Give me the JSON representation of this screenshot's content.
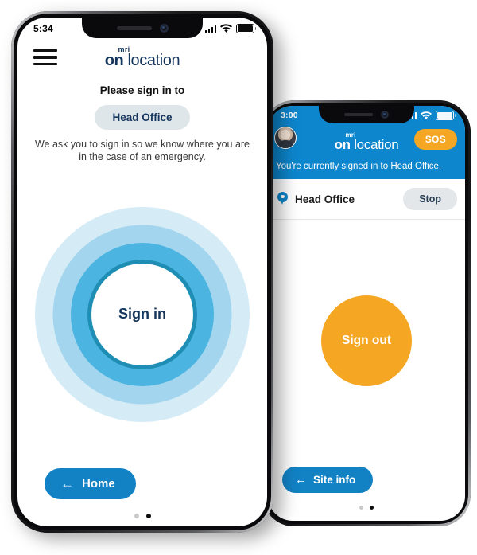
{
  "colors": {
    "brand_blue": "#0d86cd",
    "nav_blue": "#1282c5",
    "navy": "#14355c",
    "orange": "#f5a623",
    "ring_1": "#d5ecf7",
    "ring_2": "#a3d6ee",
    "ring_3": "#4cb4e0",
    "ring_4": "#1f8eb5",
    "pill_grey": "#dfe6ea"
  },
  "phone_left": {
    "status_bar": {
      "time": "5:34",
      "signal_icon": "cellular-bars-icon",
      "wifi_icon": "wifi-icon",
      "battery_icon": "battery-full-icon"
    },
    "header": {
      "menu_icon": "hamburger-menu-icon",
      "logo_top": "mri",
      "logo_main_bold": "on",
      "logo_main_thin": " location"
    },
    "prompt": "Please sign in to",
    "site_pill_label": "Head Office",
    "blurb": "We ask you to sign in so we know where you are in the case of an emergency.",
    "signin_label": "Sign in",
    "nav_button": {
      "arrow_icon": "arrow-left-icon",
      "label": "Home"
    },
    "page_dots": {
      "total": 2,
      "active_index": 1
    }
  },
  "phone_right": {
    "status_bar": {
      "time": "3:00",
      "signal_icon": "cellular-bars-icon",
      "wifi_icon": "wifi-icon",
      "battery_icon": "battery-full-icon"
    },
    "header": {
      "avatar_icon": "user-avatar-photo",
      "logo_top": "mri",
      "logo_main_bold": "on",
      "logo_main_thin": " location",
      "sos_label": "SOS"
    },
    "banner": "You're currently signed in to Head Office.",
    "site_row": {
      "pin_icon": "location-pin-icon",
      "site_name": "Head Office",
      "stop_label": "Stop"
    },
    "signout_label": "Sign out",
    "nav_button": {
      "arrow_icon": "arrow-left-icon",
      "label": "Site info"
    },
    "page_dots": {
      "total": 2,
      "active_index": 1
    }
  }
}
